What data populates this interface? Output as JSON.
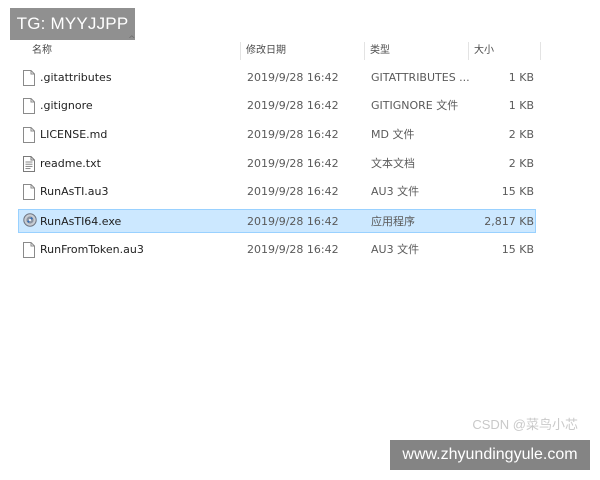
{
  "overlay_tag": "TG: MYYJJPP",
  "columns": {
    "name": "名称",
    "date": "修改日期",
    "type": "类型",
    "size": "大小"
  },
  "files": [
    {
      "name": ".gitattributes",
      "date": "2019/9/28 16:42",
      "type": "GITATTRIBUTES ...",
      "size": "1 KB",
      "icon": "blank-file-icon",
      "selected": false
    },
    {
      "name": ".gitignore",
      "date": "2019/9/28 16:42",
      "type": "GITIGNORE 文件",
      "size": "1 KB",
      "icon": "blank-file-icon",
      "selected": false
    },
    {
      "name": "LICENSE.md",
      "date": "2019/9/28 16:42",
      "type": "MD 文件",
      "size": "2 KB",
      "icon": "blank-file-icon",
      "selected": false
    },
    {
      "name": "readme.txt",
      "date": "2019/9/28 16:42",
      "type": "文本文档",
      "size": "2 KB",
      "icon": "text-file-icon",
      "selected": false
    },
    {
      "name": "RunAsTI.au3",
      "date": "2019/9/28 16:42",
      "type": "AU3 文件",
      "size": "15 KB",
      "icon": "blank-file-icon",
      "selected": false
    },
    {
      "name": "RunAsTI64.exe",
      "date": "2019/9/28 16:42",
      "type": "应用程序",
      "size": "2,817 KB",
      "icon": "exe-app-icon",
      "selected": true
    },
    {
      "name": "RunFromToken.au3",
      "date": "2019/9/28 16:42",
      "type": "AU3 文件",
      "size": "15 KB",
      "icon": "blank-file-icon",
      "selected": false
    }
  ],
  "watermark_csdn": "CSDN @菜鸟小芯",
  "watermark_site": "www.zhyundingyule.com",
  "colors": {
    "selection_bg": "#cce8ff",
    "selection_border": "#99d1ff"
  }
}
